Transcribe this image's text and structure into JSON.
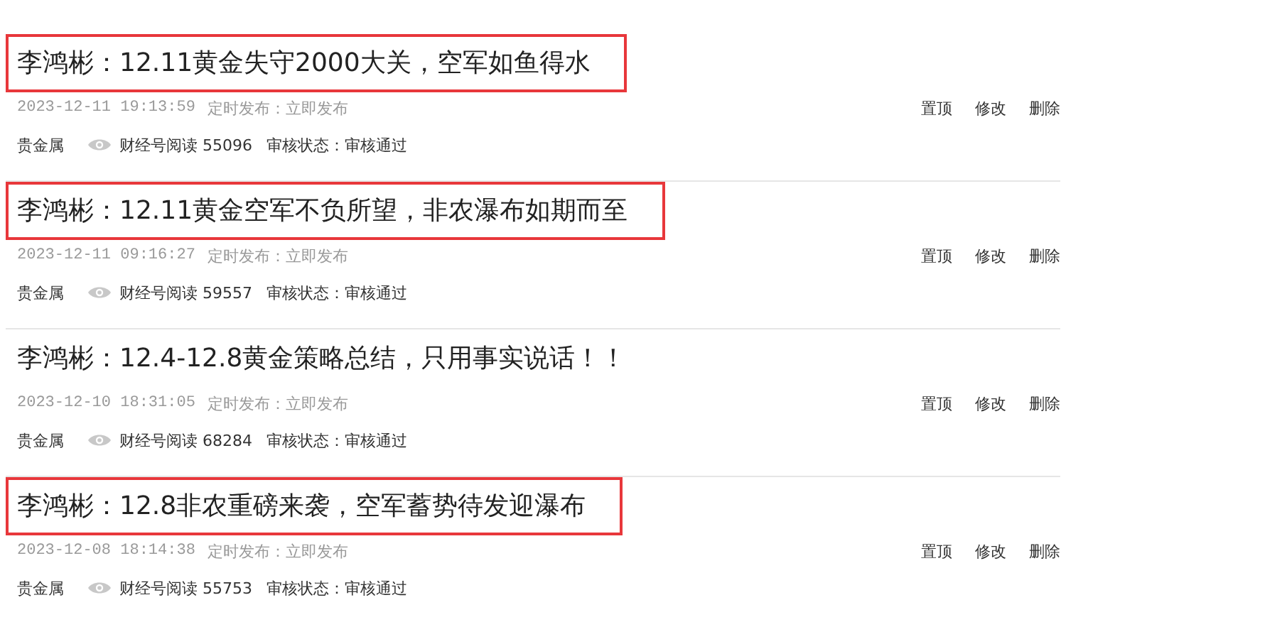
{
  "articles": [
    {
      "title": "李鸿彬：12.11黄金失守2000大关，空军如鱼得水",
      "highlighted": true,
      "date": "2023-12-11 19:13:59",
      "schedule": "定时发布：立即发布",
      "category": "贵金属",
      "reads": "财经号阅读 55096",
      "status": "审核状态：审核通过",
      "actions": [
        "置顶",
        "修改",
        "删除"
      ]
    },
    {
      "title": "李鸿彬：12.11黄金空军不负所望，非农瀑布如期而至",
      "highlighted": true,
      "date": "2023-12-11 09:16:27",
      "schedule": "定时发布：立即发布",
      "category": "贵金属",
      "reads": "财经号阅读 59557",
      "status": "审核状态：审核通过",
      "actions": [
        "置顶",
        "修改",
        "删除"
      ]
    },
    {
      "title": "李鸿彬：12.4-12.8黄金策略总结，只用事实说话！！",
      "highlighted": false,
      "date": "2023-12-10 18:31:05",
      "schedule": "定时发布：立即发布",
      "category": "贵金属",
      "reads": "财经号阅读 68284",
      "status": "审核状态：审核通过",
      "actions": [
        "置顶",
        "修改",
        "删除"
      ]
    },
    {
      "title": "李鸿彬：12.8非农重磅来袭，空军蓄势待发迎瀑布",
      "highlighted": true,
      "date": "2023-12-08 18:14:38",
      "schedule": "定时发布：立即发布",
      "category": "贵金属",
      "reads": "财经号阅读 55753",
      "status": "审核状态：审核通过",
      "actions": [
        "置顶",
        "修改",
        "删除"
      ]
    }
  ]
}
